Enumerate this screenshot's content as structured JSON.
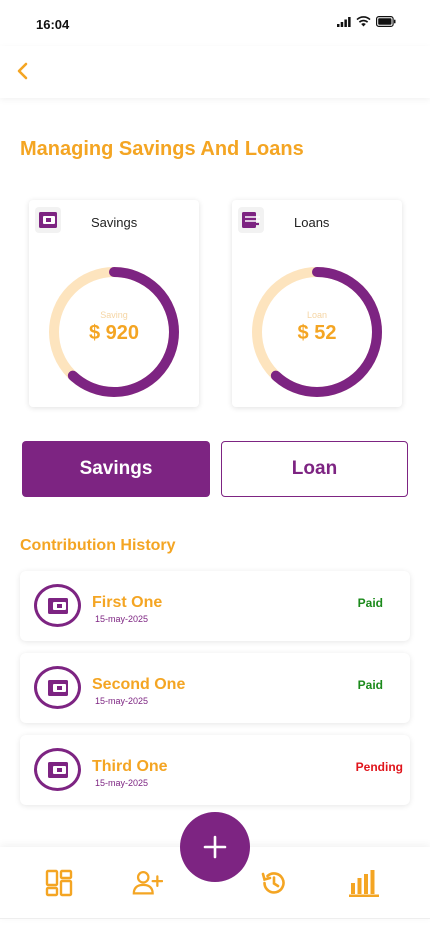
{
  "status_bar": {
    "time": "16:04"
  },
  "header": {
    "back_icon": "chevron-left-icon"
  },
  "page": {
    "title": "Managing Savings And Loans"
  },
  "cards": {
    "savings": {
      "label": "Savings",
      "donut_label": "Saving",
      "value": "$ 920",
      "progress": 0.62
    },
    "loans": {
      "label": "Loans",
      "donut_label": "Loan",
      "value": "$ 52",
      "progress": 0.62
    }
  },
  "tabs": {
    "savings": "Savings",
    "loan": "Loan"
  },
  "history": {
    "title": "Contribution History",
    "items": [
      {
        "name": "First One",
        "date": "15-may-2025",
        "status": "Paid"
      },
      {
        "name": "Second One",
        "date": "15-may-2025",
        "status": "Paid"
      },
      {
        "name": "Third One",
        "date": "15-may-2025",
        "status": "Pending"
      }
    ]
  },
  "nav": {
    "items": [
      "dashboard-icon",
      "add-user-icon",
      "history-icon",
      "bar-chart-icon"
    ],
    "fab_icon": "plus-icon"
  },
  "colors": {
    "primary": "#7D2482",
    "accent": "#F4A523",
    "ring_track": "#FDE4BE",
    "paid": "#1B8A1B",
    "pending": "#E0141B"
  }
}
